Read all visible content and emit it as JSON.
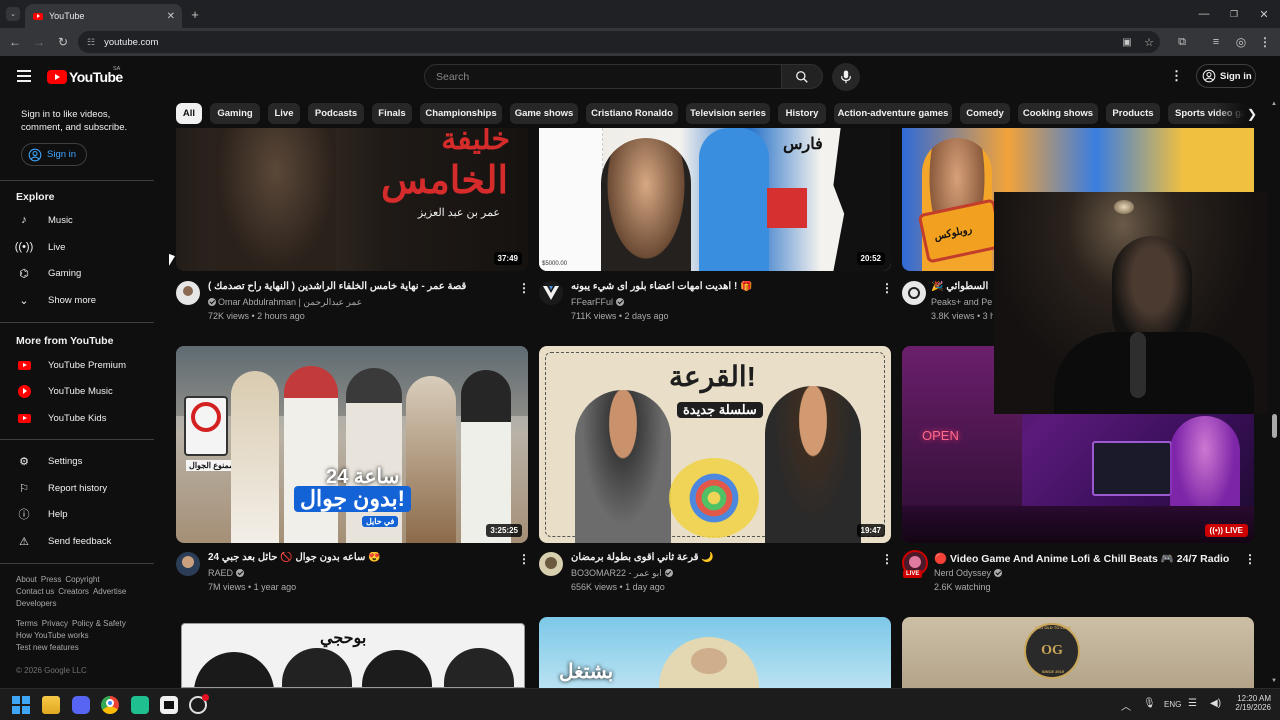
{
  "browser": {
    "tab_title": "YouTube",
    "tab_close": "✕",
    "new_tab": "+",
    "url": "youtube.com"
  },
  "header": {
    "logo_text": "YouTube",
    "country_code": "SA",
    "search_placeholder": "Search",
    "sign_in": "Sign in"
  },
  "chips": [
    "All",
    "Gaming",
    "Live",
    "Podcasts",
    "Finals",
    "Championships",
    "Game shows",
    "Cristiano Ronaldo",
    "Television series",
    "History",
    "Action-adventure games",
    "Comedy",
    "Cooking shows",
    "Products",
    "Sports video games"
  ],
  "sidebar": {
    "signin_prompt": "Sign in to like videos, comment, and subscribe.",
    "signin_button": "Sign in",
    "explore_heading": "Explore",
    "explore_items": [
      "Music",
      "Live",
      "Gaming",
      "Show more"
    ],
    "more_heading": "More from YouTube",
    "more_items": [
      "YouTube Premium",
      "YouTube Music",
      "YouTube Kids"
    ],
    "settings_items": [
      "Settings",
      "Report history",
      "Help",
      "Send feedback"
    ],
    "footer_line1": [
      "About",
      "Press",
      "Copyright"
    ],
    "footer_line2": [
      "Contact us",
      "Creators",
      "Advertise"
    ],
    "footer_line3": [
      "Developers"
    ],
    "footer_line4": [
      "Terms",
      "Privacy",
      "Policy & Safety"
    ],
    "footer_line5": [
      "How YouTube works"
    ],
    "footer_line6": [
      "Test new features"
    ],
    "copyright": "© 2026 Google LLC"
  },
  "videos": [
    {
      "title": "قصة عمر - نهاية خامس الخلفاء الراشدين ( النهاية راح تصدمك )",
      "channel": "Omar Abdulrahman | عمر عبدالرحمن",
      "meta": "72K views • 2 hours ago",
      "duration": "37:49",
      "thumb_text_1": "الخامس",
      "thumb_text_2": "عمر بن عبد العزيز",
      "thumb_text_3": "خليفة"
    },
    {
      "title": "أهديت امهات اعضاء بلور اى شيء يبونه ! 🎁",
      "channel": "FFearFFul",
      "meta": "711K views • 2 days ago",
      "duration": "20:52",
      "thumb_text_1": "فارس",
      "thumb_text_2": "$5000.00"
    },
    {
      "title": "🎉 بلبيط السطوائي",
      "channel": "Peaks+ and Pe",
      "meta": "3.8K views • 3 h",
      "thumb_text_1": "روبلوكس"
    },
    {
      "title": "24 ساعه بدون جوال 🚫 حائل بعد جبي 😍",
      "channel": "RAED",
      "meta": "7M views • 1 year ago",
      "duration": "3:25:25",
      "thumb_text_1": "24 ساعة",
      "thumb_text_2": "بدون جوال!",
      "thumb_text_3": "في حايل",
      "thumb_text_4": "ممنوع الجوال"
    },
    {
      "title": "قرعة ثاني اقوى بطولة برمضان 🌙",
      "channel": "BO3OMAR22 - ابو عمر",
      "meta": "656K views • 1 day ago",
      "duration": "19:47",
      "thumb_text_1": "القرعة!",
      "thumb_text_2": "سلسلة جديدة"
    },
    {
      "title": "🔴 Video Game And Anime Lofi & Chill Beats 🎮 24/7 Radio",
      "channel": "Nerd Odyssey",
      "meta": "2.6K watching",
      "live_label": "LIVE",
      "avatar_live": "LIVE",
      "thumb_text_1": "OPEN"
    },
    {
      "thumb_text_1": "بوحجي"
    },
    {
      "thumb_text_1": "بشتغل"
    },
    {
      "thumb_text_1": "OG",
      "thumb_text_2": "TOO OLD TO LOSE",
      "thumb_text_3": "SINCE 2019"
    }
  ],
  "taskbar": {
    "lang": "ENG",
    "time": "12:20 AM",
    "date": "2/19/2026"
  },
  "colors": {
    "background": "#0f0f0f",
    "brand_red": "#ff0000",
    "link_blue": "#3ea6ff",
    "chip_bg": "#272727",
    "live_red": "#cc0000"
  }
}
